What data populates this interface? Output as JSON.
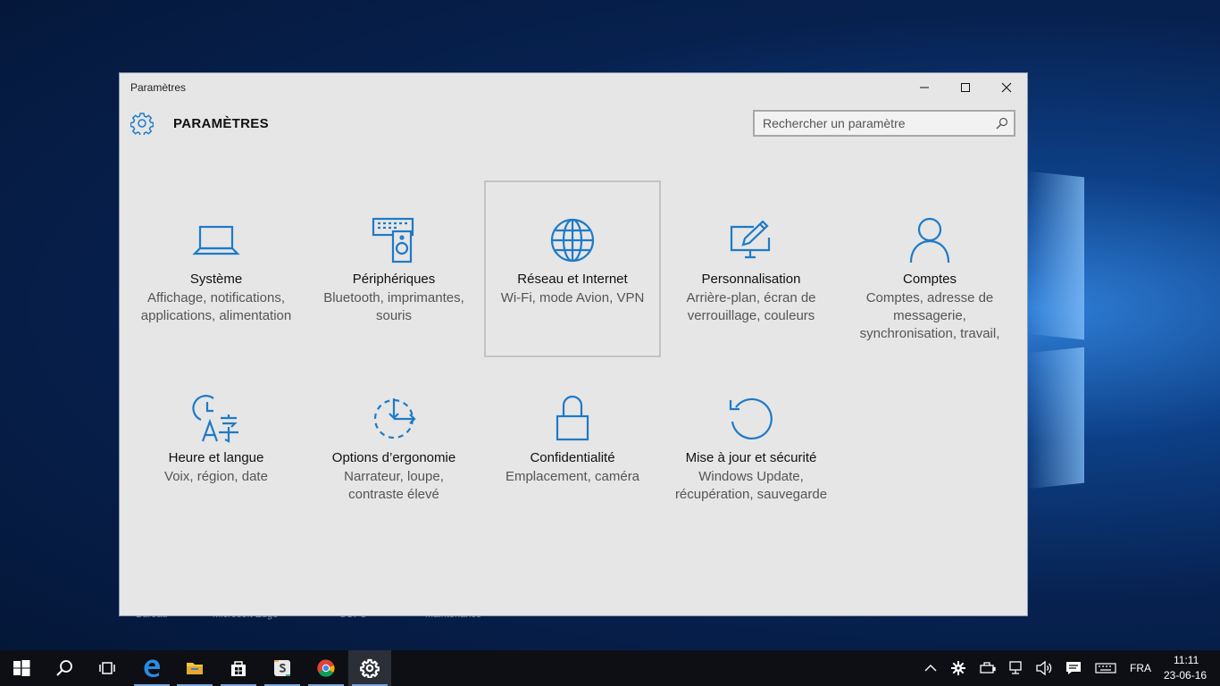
{
  "desktop": {
    "labels": [
      "Bureau",
      "Microsoft Edge",
      "SOFO",
      "Maintenance"
    ]
  },
  "window": {
    "title": "Paramètres",
    "header_title": "PARAMÈTRES",
    "search_placeholder": "Rechercher un paramètre",
    "controls": {
      "minimize": "minimize-icon",
      "maximize": "maximize-icon",
      "close": "close-icon"
    }
  },
  "tiles": [
    {
      "title": "Système",
      "desc": "Affichage, notifications, applications, alimentation",
      "icon": "laptop-icon"
    },
    {
      "title": "Périphériques",
      "desc": "Bluetooth, imprimantes, souris",
      "icon": "devices-icon"
    },
    {
      "title": "Réseau et Internet",
      "desc": "Wi-Fi, mode Avion, VPN",
      "icon": "globe-icon",
      "selected": true
    },
    {
      "title": "Personnalisation",
      "desc": "Arrière-plan, écran de verrouillage, couleurs",
      "icon": "personalization-icon"
    },
    {
      "title": "Comptes",
      "desc": "Comptes, adresse de messagerie, synchronisation, travail,",
      "icon": "person-icon"
    },
    {
      "title": "Heure et langue",
      "desc": "Voix, région, date",
      "icon": "time-language-icon"
    },
    {
      "title": "Options d’ergonomie",
      "desc": "Narrateur, loupe, contraste élevé",
      "icon": "ease-of-access-icon"
    },
    {
      "title": "Confidentialité",
      "desc": "Emplacement, caméra",
      "icon": "lock-icon"
    },
    {
      "title": "Mise à jour et sécurité",
      "desc": "Windows Update, récupération, sauvegarde",
      "icon": "update-icon"
    }
  ],
  "taskbar": {
    "apps": [
      "start-icon",
      "search-icon",
      "task-view-icon",
      "edge-icon",
      "file-explorer-icon",
      "store-icon",
      "slack-icon",
      "chrome-icon",
      "settings-icon"
    ],
    "language": "FRA",
    "time": "11:11",
    "date": "23-06-16"
  },
  "colors": {
    "accent": "#1e7ac8",
    "window_bg": "#e6e6e6",
    "taskbar_bg": "#0d0f14"
  }
}
